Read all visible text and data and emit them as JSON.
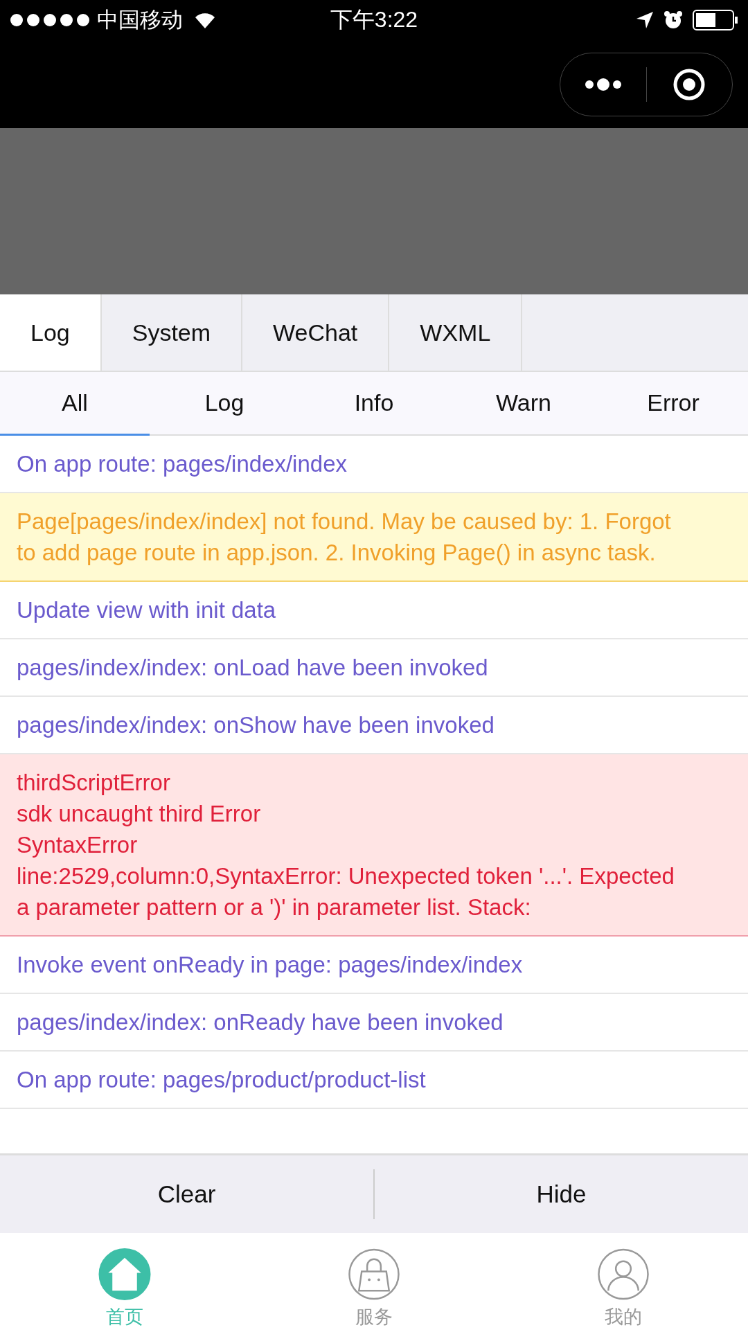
{
  "status_bar": {
    "carrier": "中国移动",
    "time": "下午3:22"
  },
  "panel_tabs": [
    {
      "label": "Log",
      "selected": true
    },
    {
      "label": "System",
      "selected": false
    },
    {
      "label": "WeChat",
      "selected": false
    },
    {
      "label": "WXML",
      "selected": false
    }
  ],
  "filters": [
    {
      "label": "All",
      "selected": true
    },
    {
      "label": "Log",
      "selected": false
    },
    {
      "label": "Info",
      "selected": false
    },
    {
      "label": "Warn",
      "selected": false
    },
    {
      "label": "Error",
      "selected": false
    }
  ],
  "logs": [
    {
      "kind": "log",
      "lines": [
        "On app route: pages/index/index"
      ]
    },
    {
      "kind": "warn",
      "lines": [
        "Page[pages/index/index] not found. May be caused by: 1. Forgot to add page route in app.json. 2. Invoking Page() in async task."
      ]
    },
    {
      "kind": "log",
      "lines": [
        "Update view with init data"
      ]
    },
    {
      "kind": "log",
      "lines": [
        "pages/index/index: onLoad have been invoked"
      ]
    },
    {
      "kind": "log",
      "lines": [
        "pages/index/index: onShow have been invoked"
      ]
    },
    {
      "kind": "error",
      "lines": [
        "thirdScriptError",
        "sdk uncaught third Error",
        "SyntaxError",
        "line:2529,column:0,SyntaxError: Unexpected token '...'. Expected a parameter pattern or a ')' in parameter list. Stack:"
      ]
    },
    {
      "kind": "log",
      "lines": [
        "Invoke event onReady in page: pages/index/index"
      ]
    },
    {
      "kind": "log",
      "lines": [
        "pages/index/index: onReady have been invoked"
      ]
    },
    {
      "kind": "log",
      "lines": [
        "On app route: pages/product/product-list"
      ]
    }
  ],
  "actions": [
    "Clear",
    "Hide"
  ],
  "tab_bar": [
    {
      "label": "首页",
      "kind": "home",
      "selected": true
    },
    {
      "label": "服务",
      "kind": "bag",
      "selected": false
    },
    {
      "label": "我的",
      "kind": "user",
      "selected": false
    }
  ]
}
